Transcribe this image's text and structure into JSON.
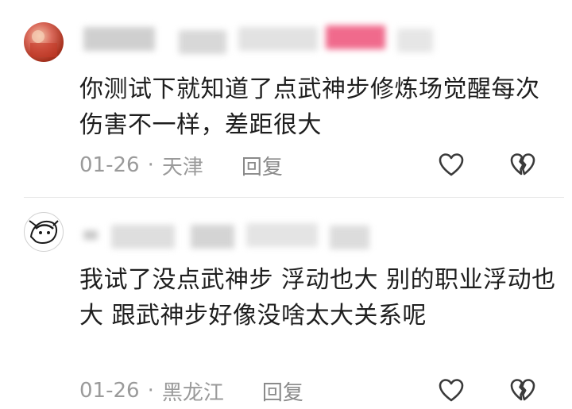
{
  "comments": [
    {
      "text": "你测试下就知道了点武神步修炼场觉醒每次伤害不一样，差距很大",
      "date": "01-26",
      "location": "天津",
      "reply_label": "回复",
      "like_icon": "heart-outline-icon",
      "dislike_icon": "broken-heart-icon"
    },
    {
      "text": "我试了没点武神步 浮动也大 别的职业浮动也大 跟武神步好像没啥太大关系呢",
      "date": "01-26",
      "location": "黑龙江",
      "reply_label": "回复",
      "like_icon": "heart-outline-icon",
      "dislike_icon": "broken-heart-icon"
    }
  ],
  "meta_separator": "·",
  "colors": {
    "text": "#1e1e1e",
    "meta": "#9a9a9a",
    "username_blur_pink": "#f06a8c"
  }
}
